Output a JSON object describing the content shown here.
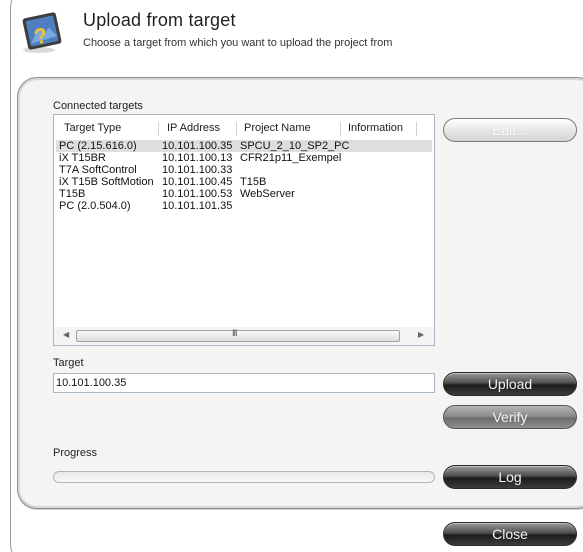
{
  "header": {
    "title": "Upload from target",
    "subtitle": "Choose a target from which you want to upload the project from",
    "icon": "upload-wizard-icon"
  },
  "targets": {
    "label": "Connected targets",
    "columns": [
      "Target Type",
      "IP Address",
      "Project Name",
      "Information"
    ],
    "rows": [
      {
        "type": "PC (2.15.616.0)",
        "ip": "10.101.100.35",
        "project": "SPCU_2_10_SP2_PC",
        "info": ""
      },
      {
        "type": "iX T15BR",
        "ip": "10.101.100.13",
        "project": "CFR21p11_Exempel",
        "info": ""
      },
      {
        "type": "T7A SoftControl",
        "ip": "10.101.100.33",
        "project": "",
        "info": ""
      },
      {
        "type": "iX T15B SoftMotion",
        "ip": "10.101.100.45",
        "project": "T15B",
        "info": ""
      },
      {
        "type": "T15B",
        "ip": "10.101.100.53",
        "project": "WebServer",
        "info": ""
      },
      {
        "type": "PC (2.0.504.0)",
        "ip": "10.101.101.35",
        "project": "",
        "info": ""
      }
    ],
    "selected_index": 0,
    "scroll_grip": "III"
  },
  "target": {
    "label": "Target",
    "value": "10.101.100.35"
  },
  "progress": {
    "label": "Progress",
    "value": 0
  },
  "buttons": {
    "edit": "Edit...",
    "upload": "Upload",
    "verify": "Verify",
    "log": "Log",
    "close": "Close"
  },
  "colors": {
    "button_dark": "#1c1c1c",
    "selection": "#dedede"
  }
}
